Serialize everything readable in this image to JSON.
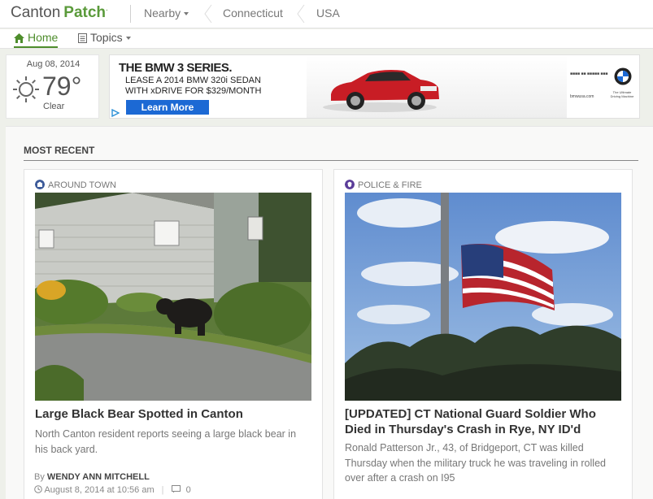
{
  "brand": {
    "first": "Canton",
    "second": "Patch"
  },
  "breadcrumb": {
    "nearby": "Nearby",
    "state": "Connecticut",
    "country": "USA"
  },
  "nav": {
    "home": "Home",
    "topics": "Topics"
  },
  "weather": {
    "date": "Aug 08, 2014",
    "temp": "79°",
    "condition": "Clear"
  },
  "ad": {
    "headline": "THE BMW 3 SERIES.",
    "line1": "LEASE A 2014 BMW 320i SEDAN",
    "line2": "WITH xDRIVE FOR $329/MONTH",
    "cta": "Learn More",
    "fine": "bmwusa.com",
    "tagline": "The Ultimate Driving Machine"
  },
  "section": {
    "title": "MOST RECENT"
  },
  "articles": [
    {
      "category": "AROUND TOWN",
      "headline": "Large Black Bear Spotted in Canton",
      "summary": "North Canton resident reports seeing a large black bear in his back yard.",
      "by_label": "By",
      "author": "WENDY ANN MITCHELL",
      "date": "August 8, 2014 at 10:56 am",
      "comments": "0"
    },
    {
      "category": "POLICE & FIRE",
      "headline": "[UPDATED] CT National Guard Soldier Who Died in Thursday's Crash in Rye, NY ID'd",
      "summary": "Ronald Patterson Jr., 43, of Bridgeport, CT was killed Thursday when the military truck he was traveling in rolled over after a crash on I95"
    }
  ]
}
